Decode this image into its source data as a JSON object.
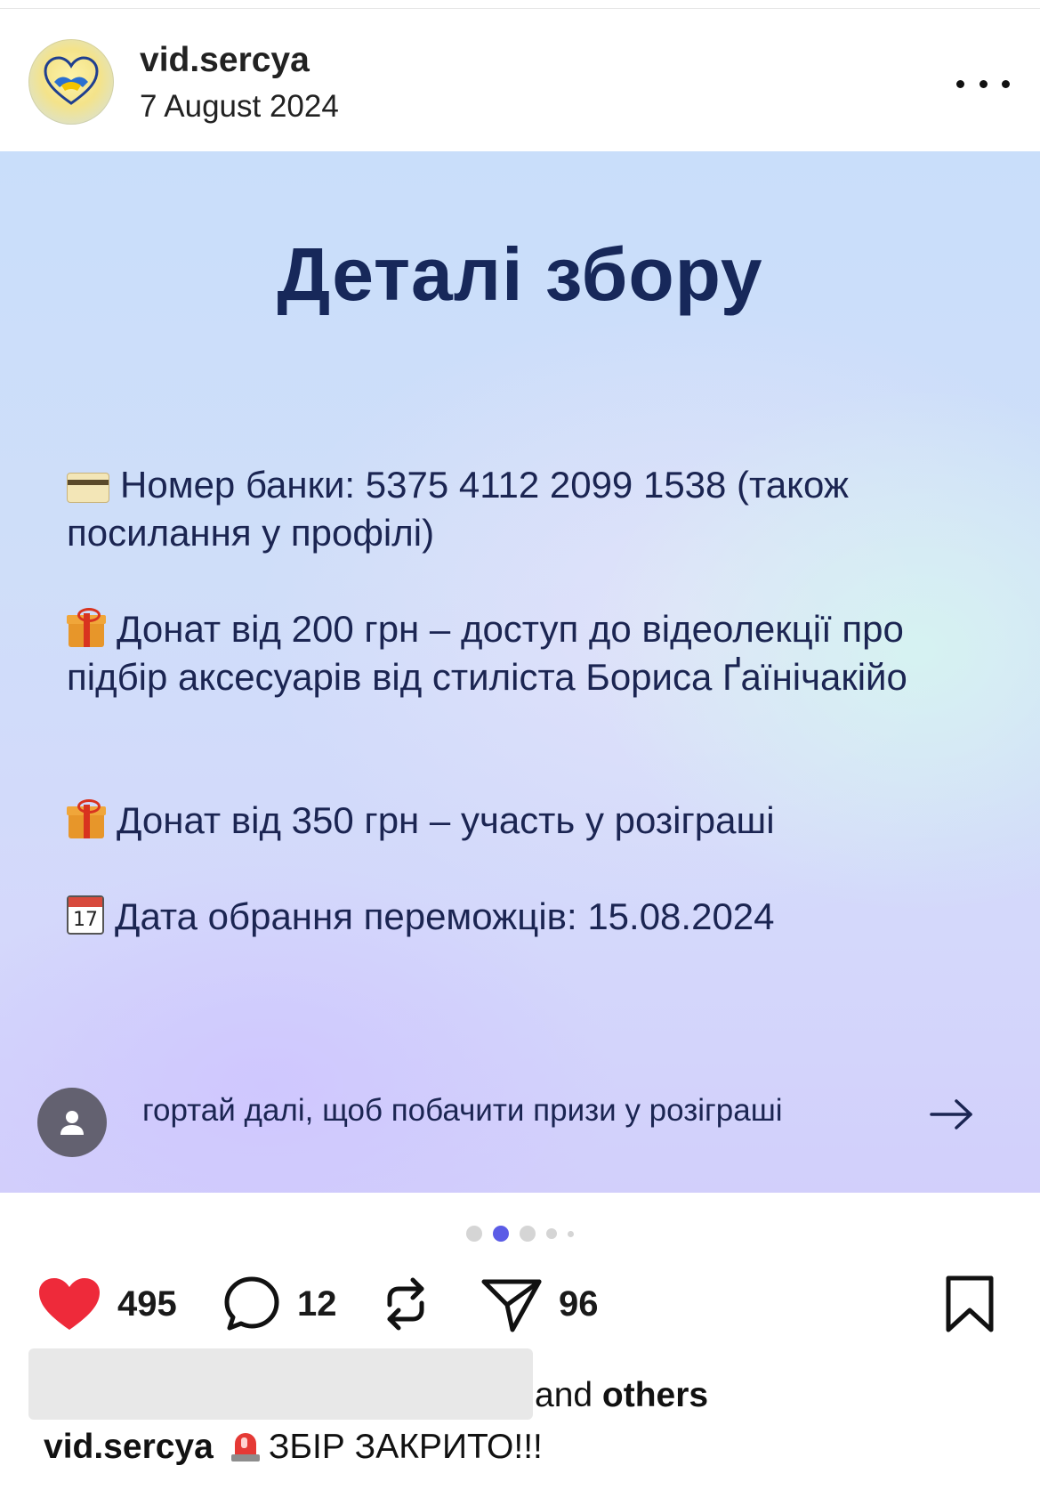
{
  "post": {
    "username": "vid.sercya",
    "date": "7 August 2024",
    "more_icon": "more-horizontal-icon"
  },
  "slide": {
    "title": "Деталі збору",
    "details": [
      {
        "icon": "credit-card-icon",
        "text": "Номер банки: 5375 4112 2099 1538 (також посилання у профілі)"
      },
      {
        "icon": "gift-icon",
        "text": "Донат від 200 грн – доступ до відеолекції про підбір аксесуарів від стиліста Бориса Ґаїнічакійо"
      },
      {
        "icon": "gift-icon",
        "text": "Донат від 350 грн – участь у розіграші"
      },
      {
        "icon": "calendar-icon",
        "calendar_day": "17",
        "text": "Дата обрання переможців: 15.08.2024"
      }
    ],
    "swipe_hint": "гортай далі, щоб побачити призи у розіграші",
    "swipe_arrow_icon": "arrow-right-icon"
  },
  "carousel": {
    "total_slides": 5,
    "active_index": 1,
    "active_color": "#5b5ce6"
  },
  "actions": {
    "likes_count": "495",
    "comments_count": "12",
    "shares_count": "96",
    "like_color": "#ee2a3a"
  },
  "likes_line": {
    "connector": "and",
    "others": "others"
  },
  "caption": {
    "username": "vid.sercya",
    "text": "ЗБІР ЗАКРИТО!!!"
  }
}
